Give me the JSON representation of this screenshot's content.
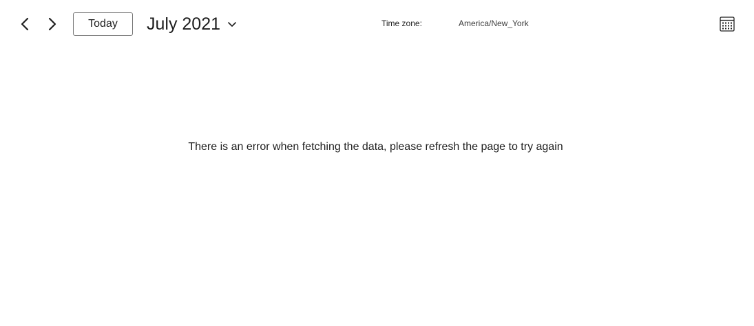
{
  "toolbar": {
    "prev_icon": "chevron-left-icon",
    "next_icon": "chevron-right-icon",
    "today_label": "Today",
    "month_label": "July 2021",
    "month_dropdown_icon": "chevron-down-icon",
    "timezone_label": "Time zone:",
    "timezone_value": "America/New_York",
    "calendar_icon": "calendar-grid-icon"
  },
  "main": {
    "error_message": "There is an error when fetching the data, please refresh the page to try again"
  },
  "colors": {
    "text": "#1e1e1e",
    "button_border": "#757575",
    "background": "#ffffff"
  }
}
